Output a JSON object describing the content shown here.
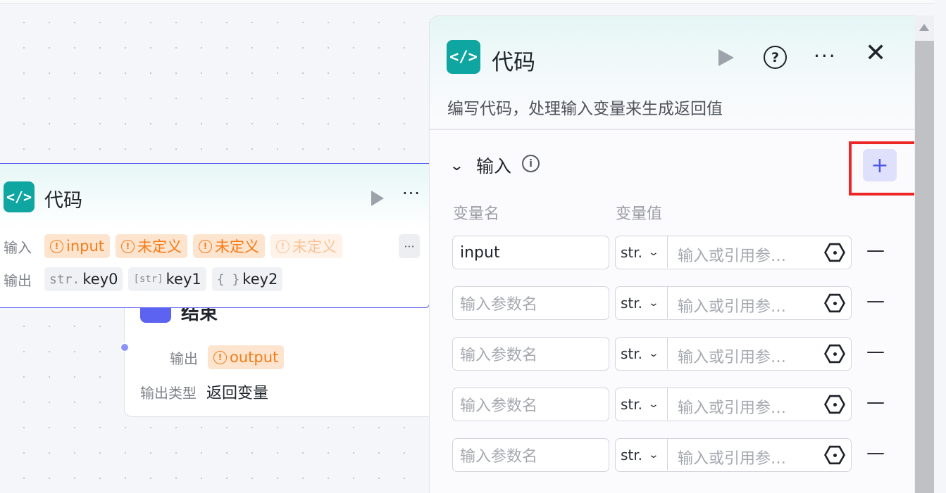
{
  "canvas": {
    "end_node": {
      "title": "结束",
      "output_label": "输出",
      "output_tag": "output",
      "output_type_label": "输出类型",
      "output_type_value": "返回变量"
    },
    "code_node": {
      "icon": "</>",
      "title": "代码",
      "input_label": "输入",
      "inputs": [
        "input",
        "未定义",
        "未定义",
        "未定义"
      ],
      "output_label": "输出",
      "outputs": [
        {
          "type": "str.",
          "name": "key0"
        },
        {
          "type": "[str]",
          "name": "key1"
        },
        {
          "type": "{ }",
          "name": "key2"
        }
      ],
      "more": "···"
    }
  },
  "panel": {
    "icon": "</>",
    "title": "代码",
    "description": "编写代码，处理输入变量来生成返回值",
    "section_title": "输入",
    "col_name": "变量名",
    "col_value": "变量值",
    "add_label": "+",
    "rows": [
      {
        "name": "input",
        "name_placeholder": "输入参数名",
        "type": "str.",
        "value_placeholder": "输入或引用参…"
      },
      {
        "name": "",
        "name_placeholder": "输入参数名",
        "type": "str.",
        "value_placeholder": "输入或引用参…"
      },
      {
        "name": "",
        "name_placeholder": "输入参数名",
        "type": "str.",
        "value_placeholder": "输入或引用参…"
      },
      {
        "name": "",
        "name_placeholder": "输入参数名",
        "type": "str.",
        "value_placeholder": "输入或引用参…"
      },
      {
        "name": "",
        "name_placeholder": "输入参数名",
        "type": "str.",
        "value_placeholder": "输入或引用参…"
      }
    ]
  },
  "colors": {
    "accent": "#5b63f0",
    "code_icon": "#0fa5a0",
    "warning": "#f57b16",
    "highlight": "#ec2626"
  }
}
